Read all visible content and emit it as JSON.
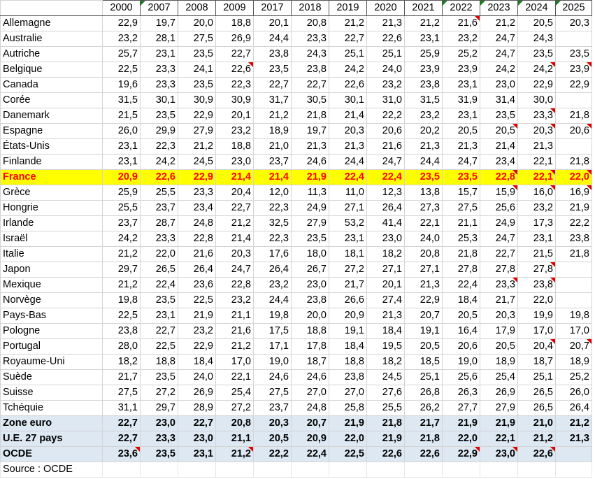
{
  "columns": [
    "2000",
    "2007",
    "2008",
    "2009",
    "2017",
    "2018",
    "2019",
    "2020",
    "2021",
    "2022",
    "2023",
    "2024",
    "2025"
  ],
  "rows": [
    {
      "name": "Allemagne",
      "values": [
        "22,9",
        "19,7",
        "20,0",
        "18,8",
        "20,1",
        "20,8",
        "21,2",
        "21,3",
        "21,2",
        "21,6",
        "21,2",
        "20,5",
        "20,3"
      ]
    },
    {
      "name": "Australie",
      "values": [
        "23,2",
        "28,1",
        "27,5",
        "26,9",
        "24,4",
        "23,3",
        "22,7",
        "22,6",
        "23,1",
        "23,2",
        "24,7",
        "24,3",
        ""
      ]
    },
    {
      "name": "Autriche",
      "values": [
        "25,7",
        "23,1",
        "23,5",
        "22,7",
        "23,8",
        "24,3",
        "25,1",
        "25,1",
        "25,9",
        "25,2",
        "24,7",
        "23,5",
        "23,5"
      ]
    },
    {
      "name": "Belgique",
      "values": [
        "22,5",
        "23,3",
        "24,1",
        "22,6",
        "23,5",
        "23,8",
        "24,2",
        "24,0",
        "23,9",
        "23,9",
        "24,2",
        "24,2",
        "23,9"
      ]
    },
    {
      "name": "Canada",
      "values": [
        "19,6",
        "23,3",
        "23,5",
        "22,3",
        "22,7",
        "22,7",
        "22,6",
        "23,2",
        "23,8",
        "23,1",
        "23,0",
        "22,9",
        "22,9"
      ]
    },
    {
      "name": "Corée",
      "values": [
        "31,5",
        "30,1",
        "30,9",
        "30,9",
        "31,7",
        "30,5",
        "30,1",
        "31,0",
        "31,5",
        "31,9",
        "31,4",
        "30,0",
        ""
      ]
    },
    {
      "name": "Danemark",
      "values": [
        "21,5",
        "23,5",
        "22,9",
        "20,1",
        "21,2",
        "21,8",
        "21,4",
        "22,2",
        "23,2",
        "23,1",
        "23,5",
        "23,3",
        "21,8"
      ]
    },
    {
      "name": "Espagne",
      "values": [
        "26,0",
        "29,9",
        "27,9",
        "23,2",
        "18,9",
        "19,7",
        "20,3",
        "20,6",
        "20,2",
        "20,5",
        "20,5",
        "20,3",
        "20,6"
      ]
    },
    {
      "name": "États-Unis",
      "values": [
        "23,1",
        "22,3",
        "21,2",
        "18,8",
        "21,0",
        "21,3",
        "21,3",
        "21,6",
        "21,3",
        "21,3",
        "21,4",
        "21,3",
        ""
      ]
    },
    {
      "name": "Finlande",
      "values": [
        "23,1",
        "24,2",
        "24,5",
        "23,0",
        "23,7",
        "24,6",
        "24,4",
        "24,7",
        "24,4",
        "24,7",
        "23,4",
        "22,1",
        "21,8"
      ]
    },
    {
      "name": "France",
      "values": [
        "20,9",
        "22,6",
        "22,9",
        "21,4",
        "21,4",
        "21,9",
        "22,4",
        "22,4",
        "23,5",
        "23,5",
        "22,8",
        "22,1",
        "22,0"
      ],
      "highlight": true
    },
    {
      "name": "Grèce",
      "values": [
        "25,9",
        "25,5",
        "23,3",
        "20,4",
        "12,0",
        "11,3",
        "11,0",
        "12,3",
        "13,8",
        "15,7",
        "15,9",
        "16,0",
        "16,9"
      ]
    },
    {
      "name": "Hongrie",
      "values": [
        "25,5",
        "23,7",
        "23,4",
        "22,7",
        "22,3",
        "24,9",
        "27,1",
        "26,4",
        "27,3",
        "27,5",
        "25,6",
        "23,2",
        "21,9"
      ]
    },
    {
      "name": "Irlande",
      "values": [
        "23,7",
        "28,7",
        "24,8",
        "21,2",
        "32,5",
        "27,9",
        "53,2",
        "41,4",
        "22,1",
        "21,1",
        "24,9",
        "17,3",
        "22,2"
      ]
    },
    {
      "name": "Israël",
      "values": [
        "24,2",
        "23,3",
        "22,8",
        "21,4",
        "22,3",
        "23,5",
        "23,1",
        "23,0",
        "24,0",
        "25,3",
        "24,7",
        "23,1",
        "23,8"
      ]
    },
    {
      "name": "Italie",
      "values": [
        "21,2",
        "22,0",
        "21,6",
        "20,3",
        "17,6",
        "18,0",
        "18,1",
        "18,2",
        "20,8",
        "21,8",
        "22,7",
        "21,5",
        "21,8"
      ]
    },
    {
      "name": "Japon",
      "values": [
        "29,7",
        "26,5",
        "26,4",
        "24,7",
        "26,4",
        "26,7",
        "27,2",
        "27,1",
        "27,1",
        "27,8",
        "27,8",
        "27,8",
        ""
      ]
    },
    {
      "name": "Mexique",
      "values": [
        "21,2",
        "22,4",
        "23,6",
        "22,8",
        "23,2",
        "23,0",
        "21,7",
        "20,1",
        "21,3",
        "22,4",
        "23,3",
        "23,8",
        ""
      ]
    },
    {
      "name": "Norvège",
      "values": [
        "19,8",
        "23,5",
        "22,5",
        "23,2",
        "24,4",
        "23,8",
        "26,6",
        "27,4",
        "22,9",
        "18,4",
        "21,7",
        "22,0",
        ""
      ]
    },
    {
      "name": "Pays-Bas",
      "values": [
        "22,5",
        "23,1",
        "21,9",
        "21,1",
        "19,8",
        "20,0",
        "20,9",
        "21,3",
        "20,7",
        "20,5",
        "20,3",
        "19,9",
        "19,8"
      ]
    },
    {
      "name": "Pologne",
      "values": [
        "23,8",
        "22,7",
        "23,2",
        "21,6",
        "17,5",
        "18,8",
        "19,1",
        "18,4",
        "19,1",
        "16,4",
        "17,9",
        "17,0",
        "17,0"
      ]
    },
    {
      "name": "Portugal",
      "values": [
        "28,0",
        "22,5",
        "22,9",
        "21,2",
        "17,1",
        "17,8",
        "18,4",
        "19,5",
        "20,5",
        "20,6",
        "20,5",
        "20,4",
        "20,7"
      ]
    },
    {
      "name": "Royaume-Uni",
      "values": [
        "18,2",
        "18,8",
        "18,4",
        "17,0",
        "19,0",
        "18,7",
        "18,8",
        "18,2",
        "18,5",
        "19,0",
        "18,9",
        "18,7",
        "18,9"
      ]
    },
    {
      "name": "Suède",
      "values": [
        "21,7",
        "23,5",
        "24,0",
        "22,1",
        "24,6",
        "24,6",
        "23,8",
        "24,5",
        "25,1",
        "25,6",
        "25,4",
        "25,1",
        "25,2"
      ]
    },
    {
      "name": "Suisse",
      "values": [
        "27,5",
        "27,2",
        "26,9",
        "25,4",
        "27,5",
        "27,0",
        "27,0",
        "27,6",
        "26,8",
        "26,3",
        "26,9",
        "26,5",
        "26,0"
      ]
    },
    {
      "name": "Tchéquie",
      "values": [
        "31,1",
        "29,7",
        "28,9",
        "27,2",
        "23,7",
        "24,8",
        "25,8",
        "25,5",
        "26,2",
        "27,7",
        "27,9",
        "26,5",
        "26,4"
      ]
    },
    {
      "name": "Zone euro",
      "values": [
        "22,7",
        "23,0",
        "22,7",
        "20,8",
        "20,3",
        "20,7",
        "21,9",
        "21,8",
        "21,7",
        "21,9",
        "21,9",
        "21,0",
        "21,2"
      ],
      "aggregate": true
    },
    {
      "name": "U.E. 27 pays",
      "values": [
        "22,7",
        "23,3",
        "23,0",
        "21,1",
        "20,5",
        "20,9",
        "22,0",
        "21,9",
        "21,8",
        "22,0",
        "22,1",
        "21,2",
        "21,3"
      ],
      "aggregate": true
    },
    {
      "name": "OCDE",
      "values": [
        "23,6",
        "23,5",
        "23,1",
        "21,2",
        "22,2",
        "22,4",
        "22,5",
        "22,6",
        "22,6",
        "22,9",
        "23,0",
        "22,6",
        ""
      ],
      "aggregate": true
    }
  ],
  "source": "Source : OCDE",
  "flagged_cells": [
    [
      0,
      9
    ],
    [
      3,
      3
    ],
    [
      3,
      11
    ],
    [
      3,
      12
    ],
    [
      6,
      11
    ],
    [
      7,
      10
    ],
    [
      7,
      11
    ],
    [
      7,
      12
    ],
    [
      10,
      10
    ],
    [
      10,
      11
    ],
    [
      10,
      12
    ],
    [
      11,
      10
    ],
    [
      11,
      11
    ],
    [
      11,
      12
    ],
    [
      16,
      11
    ],
    [
      17,
      10
    ],
    [
      17,
      11
    ],
    [
      21,
      11
    ],
    [
      21,
      12
    ],
    [
      28,
      0
    ],
    [
      28,
      3
    ],
    [
      28,
      9
    ],
    [
      28,
      10
    ],
    [
      28,
      11
    ]
  ],
  "flagged_headers": [
    1,
    9,
    10,
    11,
    12
  ],
  "colors": {
    "highlight_bg": "#ffff00",
    "highlight_text": "#ff0000",
    "aggregate_bg": "#dde8f3",
    "comment_marker": "#e00000"
  }
}
